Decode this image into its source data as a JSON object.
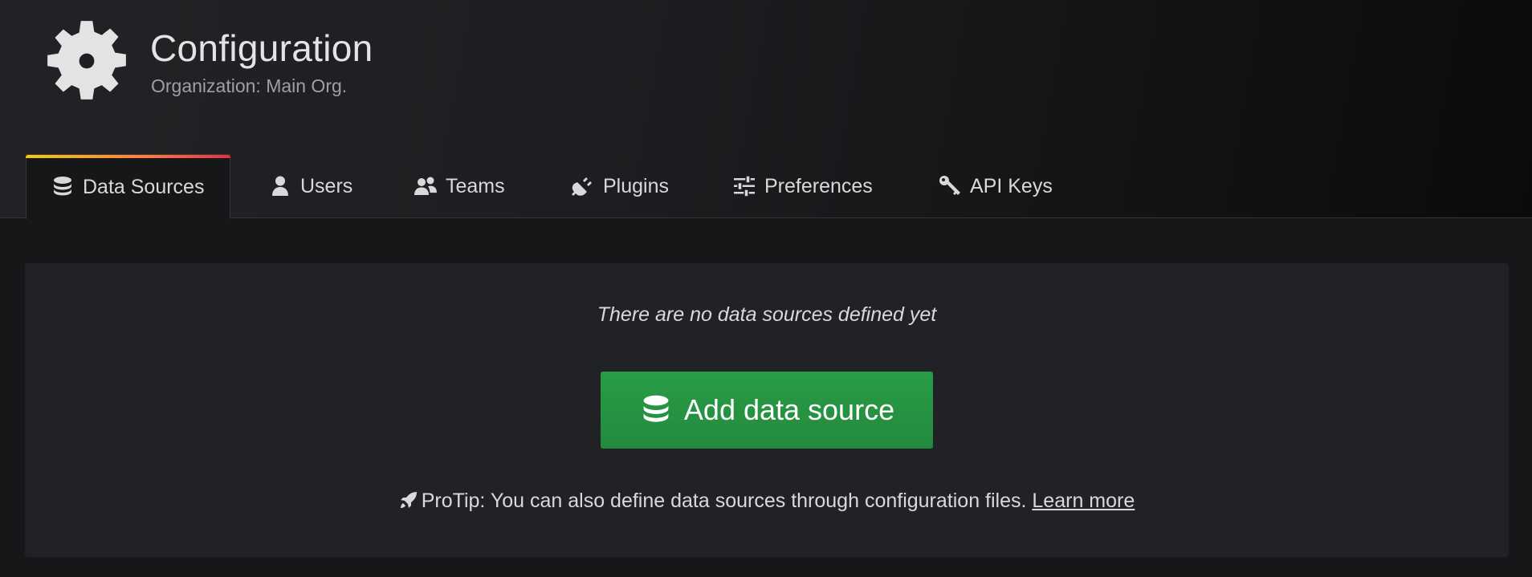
{
  "header": {
    "title": "Configuration",
    "subtitle": "Organization: Main Org.",
    "icon": "gear-icon"
  },
  "tabs": [
    {
      "label": "Data Sources",
      "icon": "database-icon",
      "active": true
    },
    {
      "label": "Users",
      "icon": "user-icon",
      "active": false
    },
    {
      "label": "Teams",
      "icon": "users-icon",
      "active": false
    },
    {
      "label": "Plugins",
      "icon": "plug-icon",
      "active": false
    },
    {
      "label": "Preferences",
      "icon": "sliders-icon",
      "active": false
    },
    {
      "label": "API Keys",
      "icon": "key-icon",
      "active": false
    }
  ],
  "empty_state": {
    "message": "There are no data sources defined yet",
    "button_label": "Add data source",
    "button_icon": "database-icon",
    "protip_text": "ProTip: You can also define data sources through configuration files.",
    "protip_icon": "rocket-icon",
    "learn_more_label": "Learn more"
  },
  "colors": {
    "accent_gradient": [
      "#f2cc0c",
      "#ff7941",
      "#e02f44"
    ],
    "button_green": "#299c46",
    "panel_bg": "#212226",
    "page_bg": "#161719"
  }
}
